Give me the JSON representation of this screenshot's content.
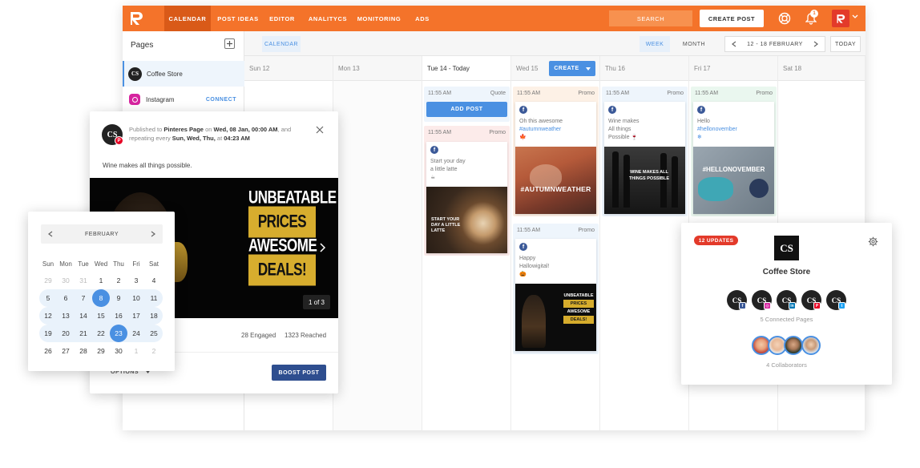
{
  "nav": {
    "items": [
      "CALENDAR",
      "POST IDEAS",
      "EDITOR",
      "ANALITYCS",
      "MONITORING",
      "ADS"
    ],
    "search_label": "SEARCH",
    "create_post_label": "CREATE POST",
    "notification_count": "1"
  },
  "sidebar": {
    "title": "Pages",
    "items": [
      {
        "label": "Coffee Store"
      },
      {
        "label": "Instagram",
        "action": "CONNECT"
      }
    ]
  },
  "calendar": {
    "view_label": "CALENDAR",
    "week_label": "WEEK",
    "month_label": "MONTH",
    "range_label": "12 - 18 FEBRUARY",
    "today_label": "TODAY",
    "create_label": "CREATE",
    "days": [
      "Sun 12",
      "Mon 13",
      "Tue 14 - Today",
      "Wed 15",
      "Thu 16",
      "Fri 17",
      "Sat 18"
    ],
    "add_post_label": "ADD POST",
    "cards": [
      {
        "time": "11:55 AM",
        "type": "Quote"
      },
      {
        "time": "11:55 AM",
        "type": "Promo",
        "text": [
          "Start your day",
          "a little latte",
          "☕"
        ],
        "img_text": "START YOUR DAY A LITTLE LATTE"
      },
      {
        "time": "11:55 AM",
        "type": "Promo",
        "text": [
          "Oh this awesome"
        ],
        "tag": "#autumnweather",
        "emoji": "🍁",
        "img_text": "#AUTUMNWEATHER"
      },
      {
        "time": "11:55 AM",
        "type": "Promo",
        "text": [
          "Wine makes",
          "All things",
          "Possible 🍷"
        ],
        "img_text": "WINE MAKES ALL THINGS POSSIBLE"
      },
      {
        "time": "11:55 AM",
        "type": "Promo",
        "text": [
          "Hello"
        ],
        "tag": "#hellonovember",
        "emoji": "❄",
        "img_text": "#HELLONOVEMBER"
      },
      {
        "time": "11:55 AM",
        "type": "Promo",
        "text": [
          "Happy",
          "Hallowigital!",
          "🎃"
        ],
        "img_lines": [
          "UNBEATABLE",
          "PRICES",
          "AWESOME",
          "DEALS!"
        ]
      }
    ]
  },
  "popup": {
    "avatar": "CS",
    "published_prefix": "Published to ",
    "page_name": "Pinteres Page",
    "on": " on ",
    "date": "Wed, 08 Jan, 00:00 AM",
    "and": ", and",
    "repeat_prefix": "repeating every ",
    "repeat_days": "Sun, Wed, Thu,",
    "at": " at ",
    "repeat_time": "04:23 AM",
    "message": "Wine makes all things possible.",
    "promo_lines": [
      "UNBEATABLE",
      "PRICES",
      "AWESOME",
      "DEALS!"
    ],
    "counter": "1 of 3",
    "engaged": "28 Engaged",
    "reached": "1323 Reached",
    "options_label": "OPTIONS",
    "boost_label": "BOOST POST"
  },
  "datepicker": {
    "month": "FEBRUARY",
    "weekdays": [
      "Sun",
      "Mon",
      "Tue",
      "Wed",
      "Thu",
      "Fri",
      "Sat"
    ],
    "weeks": [
      [
        "29",
        "30",
        "31",
        "1",
        "2",
        "3",
        "4"
      ],
      [
        "5",
        "6",
        "7",
        "8",
        "9",
        "10",
        "11"
      ],
      [
        "12",
        "13",
        "14",
        "15",
        "16",
        "17",
        "18"
      ],
      [
        "19",
        "20",
        "21",
        "22",
        "23",
        "24",
        "25"
      ],
      [
        "26",
        "27",
        "28",
        "29",
        "30",
        "1",
        "2"
      ]
    ],
    "selected": [
      "8",
      "23"
    ]
  },
  "profile": {
    "updates": "12 UPDATES",
    "logo": "CS",
    "name": "Coffee Store",
    "connected": "5 Connected Pages",
    "collaborators": "4 Collaborators",
    "networks": [
      "f",
      "ig",
      "in",
      "p",
      "t"
    ]
  },
  "colors": {
    "brand": "#f4732a",
    "accent": "#4a90e2",
    "red": "#e33a2a",
    "facebook": "#3b5998"
  }
}
